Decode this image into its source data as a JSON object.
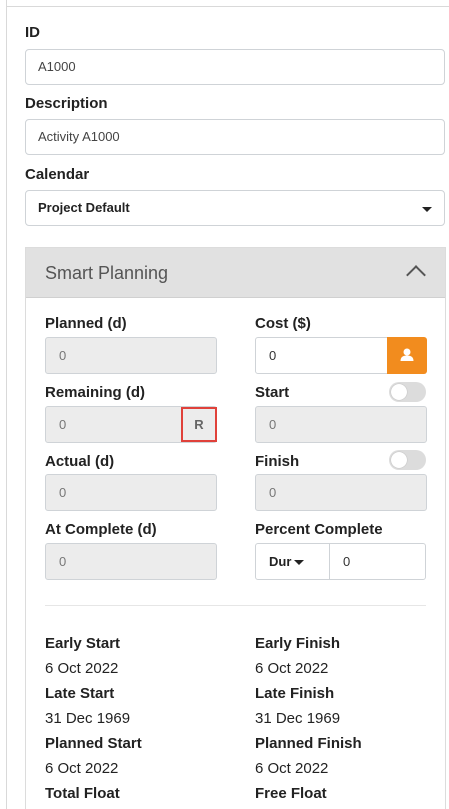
{
  "form": {
    "id_label": "ID",
    "id_value": "A1000",
    "description_label": "Description",
    "description_value": "Activity A1000",
    "calendar_label": "Calendar",
    "calendar_value": "Project Default"
  },
  "smart_planning": {
    "title": "Smart Planning",
    "planned_label": "Planned (d)",
    "planned_value": "0",
    "cost_label": "Cost ($)",
    "cost_value": "0",
    "remaining_label": "Remaining (d)",
    "remaining_value": "0",
    "remaining_button": "R",
    "start_label": "Start",
    "start_value": "0",
    "actual_label": "Actual (d)",
    "actual_value": "0",
    "finish_label": "Finish",
    "finish_value": "0",
    "at_complete_label": "At Complete (d)",
    "at_complete_value": "0",
    "percent_complete_label": "Percent Complete",
    "percent_type": "Dur",
    "percent_value": "0"
  },
  "dates": {
    "early_start_label": "Early Start",
    "early_start_value": "6 Oct 2022",
    "early_finish_label": "Early Finish",
    "early_finish_value": "6 Oct 2022",
    "late_start_label": "Late Start",
    "late_start_value": "31 Dec 1969",
    "late_finish_label": "Late Finish",
    "late_finish_value": "31 Dec 1969",
    "planned_start_label": "Planned Start",
    "planned_start_value": "6 Oct 2022",
    "planned_finish_label": "Planned Finish",
    "planned_finish_value": "6 Oct 2022",
    "total_float_label": "Total Float",
    "free_float_label": "Free Float"
  },
  "colors": {
    "accent": "#f28c1e",
    "highlight_border": "#e0413a",
    "panel_header_bg": "#e1e1e1"
  }
}
